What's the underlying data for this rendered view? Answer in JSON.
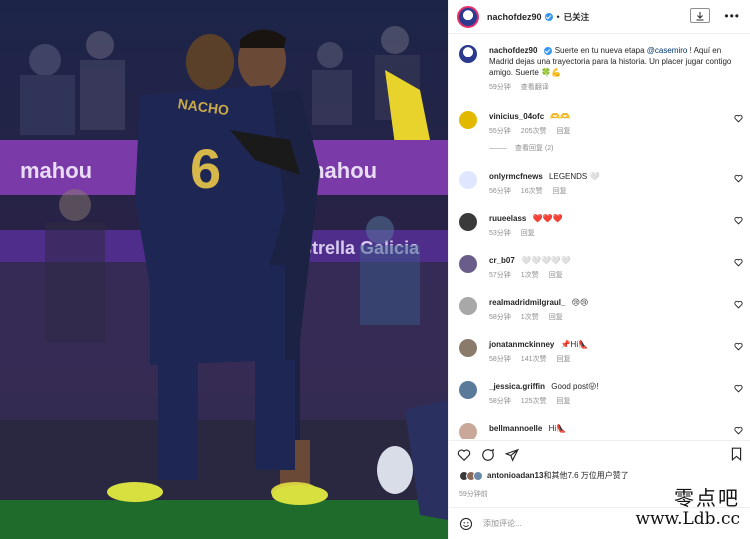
{
  "header": {
    "username": "nachofdez90",
    "separator": "•",
    "follow_status": "已关注",
    "more_icon": "•••"
  },
  "caption": {
    "username": "nachofdez90",
    "text_before": "Suerte en tu nueva etapa ",
    "mention": "@casemiro",
    "text_after": " ! Aquí en Madrid dejas una trayectoria para la historia. Un placer jugar contigo amigo. Suerte 🍀💪",
    "time": "59分钟",
    "translate": "查看翻译"
  },
  "comments": [
    {
      "username": "vinicius_04ofc",
      "text": "🫶🫶",
      "time": "55分钟",
      "likes": "205次赞",
      "reply": "回复",
      "avatar_color": "#e3b800",
      "view_replies": "查看回复 (2)"
    },
    {
      "username": "onlyrmcfnews",
      "text": "LEGENDS 🤍",
      "time": "56分钟",
      "likes": "16次赞",
      "reply": "回复",
      "avatar_color": "#dfe6ff"
    },
    {
      "username": "ruueelass",
      "text": "❤️❤️❤️",
      "time": "53分钟",
      "likes": "",
      "reply": "回复",
      "avatar_color": "#3a3a3a"
    },
    {
      "username": "cr_b07",
      "text": "🤍🤍🤍🤍🤍",
      "time": "57分钟",
      "likes": "1次赞",
      "reply": "回复",
      "avatar_color": "#6b5d8a"
    },
    {
      "username": "realmadridmilgraul_",
      "text": "😢😢",
      "time": "58分钟",
      "likes": "1次赞",
      "reply": "回复",
      "avatar_color": "#a8a8a8"
    },
    {
      "username": "jonatanmckinney",
      "text": "📌Hi👠",
      "time": "58分钟",
      "likes": "141次赞",
      "reply": "回复",
      "avatar_color": "#8a7a6a"
    },
    {
      "username": "_jessica.griffin",
      "text": "Good post😛!",
      "time": "58分钟",
      "likes": "125次赞",
      "reply": "回复",
      "avatar_color": "#5a7a9a"
    },
    {
      "username": "bellmannoelle",
      "text": "Hi👠",
      "time": "58分钟",
      "likes": "153次赞",
      "reply": "回复",
      "avatar_color": "#c9a89a"
    }
  ],
  "likes_summary": {
    "user": "antonioadan13",
    "rest": "和其他7.6 万位用户赞了"
  },
  "post_time": "59分钟前",
  "comment_input": {
    "placeholder": "添加评论..."
  },
  "watermark": {
    "line1": "零点吧",
    "line2": "www.Ldb.cc"
  },
  "photo": {
    "player_name": "NACHO",
    "player_number": "6",
    "ad_text": "mahou",
    "stadium_text": "Estrella Galicia"
  },
  "colors": {
    "link": "#00376b",
    "verified": "#3897f0",
    "muted": "#8e8e8e"
  }
}
